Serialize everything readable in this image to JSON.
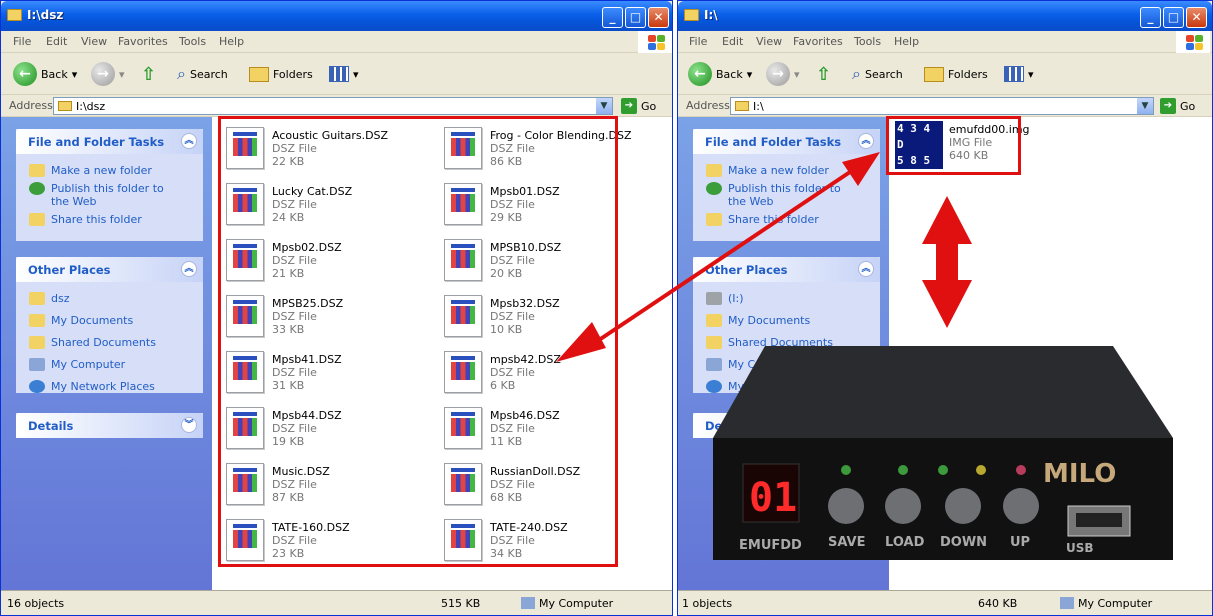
{
  "left_window": {
    "title": "I:\\dsz",
    "menu": [
      "File",
      "Edit",
      "View",
      "Favorites",
      "Tools",
      "Help"
    ],
    "back": "Back",
    "search": "Search",
    "folders": "Folders",
    "address_label": "Address",
    "address": "I:\\dsz",
    "go": "Go",
    "tasks_title": "File and Folder Tasks",
    "tasks": [
      "Make a new folder",
      "Publish this folder to the Web",
      "Share this folder"
    ],
    "places_title": "Other Places",
    "places": [
      "dsz",
      "My Documents",
      "Shared Documents",
      "My Computer",
      "My Network Places"
    ],
    "details_title": "Details",
    "files": [
      {
        "name": "Acoustic Guitars.DSZ",
        "type": "DSZ File",
        "size": "22 KB"
      },
      {
        "name": "Frog - Color Blending.DSZ",
        "type": "DSZ File",
        "size": "86 KB"
      },
      {
        "name": "Lucky Cat.DSZ",
        "type": "DSZ File",
        "size": "24 KB"
      },
      {
        "name": "Mpsb01.DSZ",
        "type": "DSZ File",
        "size": "29 KB"
      },
      {
        "name": "Mpsb02.DSZ",
        "type": "DSZ File",
        "size": "21 KB"
      },
      {
        "name": "MPSB10.DSZ",
        "type": "DSZ File",
        "size": "20 KB"
      },
      {
        "name": "MPSB25.DSZ",
        "type": "DSZ File",
        "size": "33 KB"
      },
      {
        "name": "Mpsb32.DSZ",
        "type": "DSZ File",
        "size": "10 KB"
      },
      {
        "name": "Mpsb41.DSZ",
        "type": "DSZ File",
        "size": "31 KB"
      },
      {
        "name": "mpsb42.DSZ",
        "type": "DSZ File",
        "size": "6 KB"
      },
      {
        "name": "Mpsb44.DSZ",
        "type": "DSZ File",
        "size": "19 KB"
      },
      {
        "name": "Mpsb46.DSZ",
        "type": "DSZ File",
        "size": "11 KB"
      },
      {
        "name": "Music.DSZ",
        "type": "DSZ File",
        "size": "87 KB"
      },
      {
        "name": "RussianDoll.DSZ",
        "type": "DSZ File",
        "size": "68 KB"
      },
      {
        "name": "TATE-160.DSZ",
        "type": "DSZ File",
        "size": "23 KB"
      },
      {
        "name": "TATE-240.DSZ",
        "type": "DSZ File",
        "size": "34 KB"
      }
    ],
    "status_objects": "16 objects",
    "status_size": "515 KB",
    "status_location": "My Computer"
  },
  "right_window": {
    "title": "I:\\",
    "menu": [
      "File",
      "Edit",
      "View",
      "Favorites",
      "Tools",
      "Help"
    ],
    "back": "Back",
    "search": "Search",
    "folders": "Folders",
    "address_label": "Address",
    "address": "I:\\",
    "go": "Go",
    "tasks_title": "File and Folder Tasks",
    "tasks": [
      "Make a new folder",
      "Publish this folder to the Web",
      "Share this folder"
    ],
    "places_title": "Other Places",
    "places": [
      "(I:)",
      "My Documents",
      "Shared Documents",
      "My Computer",
      "My Network"
    ],
    "details_title": "Detai",
    "file": {
      "name": "emufdd00.img",
      "type": "IMG File",
      "size": "640 KB",
      "thumb_lines": [
        "4 3 4 D",
        "5 8 5 6",
        "4 9 2 0"
      ]
    },
    "status_objects": "1 objects",
    "status_size": "640 KB",
    "status_location": "My Computer"
  },
  "device": {
    "display": "01",
    "brand": "MILO",
    "labels": [
      "EMUFDD",
      "SAVE",
      "LOAD",
      "DOWN",
      "UP",
      "USB"
    ]
  },
  "colors": {
    "highlight": "#e01010",
    "link": "#215dc6"
  }
}
